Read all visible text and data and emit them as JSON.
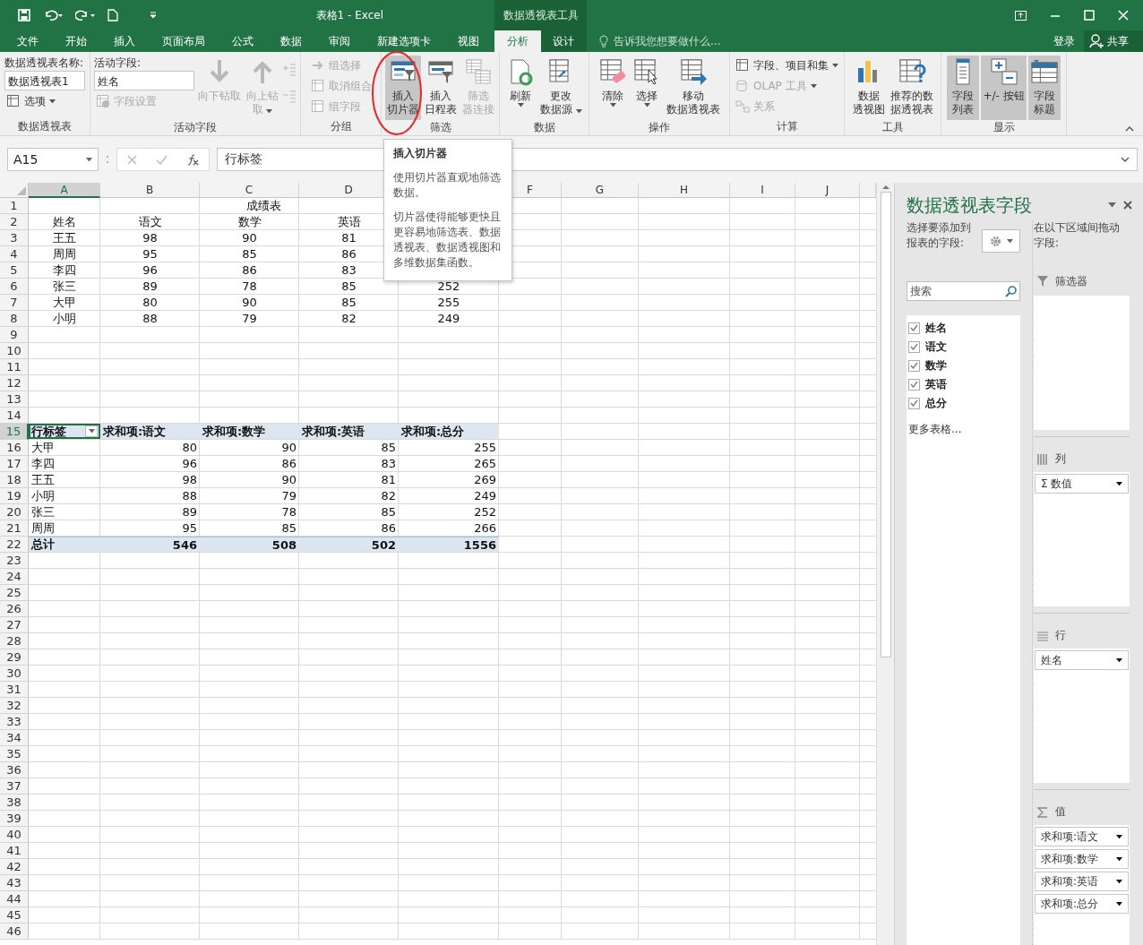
{
  "title_bar": {
    "title": "表格1 - Excel",
    "context_label": "数据透视表工具"
  },
  "tabs": [
    {
      "label": "文件",
      "selected": false
    },
    {
      "label": "开始",
      "selected": false
    },
    {
      "label": "插入",
      "selected": false
    },
    {
      "label": "页面布局",
      "selected": false
    },
    {
      "label": "公式",
      "selected": false
    },
    {
      "label": "数据",
      "selected": false
    },
    {
      "label": "审阅",
      "selected": false
    },
    {
      "label": "新建选项卡",
      "selected": false
    },
    {
      "label": "视图",
      "selected": false
    }
  ],
  "context_tabs": [
    {
      "label": "分析",
      "selected": true
    },
    {
      "label": "设计",
      "selected": false
    }
  ],
  "tell_me": {
    "placeholder": "告诉我您想要做什么..."
  },
  "account": {
    "sign_in": "登录",
    "share": "共享"
  },
  "ribbon": {
    "groups": [
      {
        "label": "数据透视表",
        "columns": [
          [
            {
              "kind": "name_field",
              "label": "数据透视表名称:",
              "value": "数据透视表1"
            },
            {
              "kind": "small",
              "label": "选项",
              "dropdown": true,
              "disabled": false
            }
          ]
        ]
      },
      {
        "label": "活动字段",
        "columns": [
          [
            {
              "kind": "name_field",
              "label": "活动字段:",
              "value": "姓名"
            },
            {
              "kind": "small",
              "label": "字段设置",
              "dropdown": false,
              "disabled": true
            }
          ],
          [
            {
              "kind": "large",
              "lines": [
                "向下钻取"
              ],
              "dropdown": false,
              "disabled": true,
              "on": false,
              "annotated": false
            }
          ],
          [
            {
              "kind": "large",
              "lines": [
                "向上钻",
                "取"
              ],
              "dropdown": true,
              "disabled": true,
              "on": false,
              "annotated": false
            }
          ],
          [
            {
              "kind": "icon_stack",
              "disabled": true
            }
          ]
        ]
      },
      {
        "label": "分组",
        "columns": [
          [
            {
              "kind": "small",
              "label": "组选择",
              "dropdown": false,
              "disabled": true
            },
            {
              "kind": "small",
              "label": "取消组合",
              "dropdown": false,
              "disabled": true
            },
            {
              "kind": "small",
              "label": "组字段",
              "dropdown": false,
              "disabled": true
            }
          ]
        ]
      },
      {
        "label": "筛选",
        "columns": [
          [
            {
              "kind": "large",
              "lines": [
                "插入",
                "切片器"
              ],
              "dropdown": false,
              "disabled": false,
              "on": true,
              "annotated": true
            }
          ],
          [
            {
              "kind": "large",
              "lines": [
                "插入",
                "日程表"
              ],
              "dropdown": false,
              "disabled": false,
              "on": false,
              "annotated": false
            }
          ],
          [
            {
              "kind": "large",
              "lines": [
                "筛选",
                "器连接"
              ],
              "dropdown": false,
              "disabled": true,
              "on": false,
              "annotated": false
            }
          ]
        ]
      },
      {
        "label": "数据",
        "columns": [
          [
            {
              "kind": "large",
              "lines": [
                "刷新"
              ],
              "dropdown": true,
              "disabled": false,
              "on": false,
              "annotated": false
            }
          ],
          [
            {
              "kind": "large",
              "lines": [
                "更改",
                "数据源"
              ],
              "dropdown": true,
              "disabled": false,
              "on": false,
              "annotated": false
            }
          ]
        ]
      },
      {
        "label": "操作",
        "columns": [
          [
            {
              "kind": "large",
              "lines": [
                "清除"
              ],
              "dropdown": true,
              "disabled": false,
              "on": false,
              "annotated": false
            }
          ],
          [
            {
              "kind": "large",
              "lines": [
                "选择"
              ],
              "dropdown": true,
              "disabled": false,
              "on": false,
              "annotated": false
            }
          ],
          [
            {
              "kind": "large",
              "lines": [
                "移动",
                "数据透视表"
              ],
              "dropdown": false,
              "disabled": false,
              "on": false,
              "annotated": false
            }
          ]
        ]
      },
      {
        "label": "计算",
        "columns": [
          [
            {
              "kind": "small",
              "label": "字段、项目和集",
              "dropdown": true,
              "disabled": false
            },
            {
              "kind": "small",
              "label": "OLAP 工具",
              "dropdown": true,
              "disabled": true
            },
            {
              "kind": "small",
              "label": "关系",
              "dropdown": false,
              "disabled": true
            }
          ]
        ]
      },
      {
        "label": "工具",
        "columns": [
          [
            {
              "kind": "large",
              "lines": [
                "数据",
                "透视图"
              ],
              "dropdown": false,
              "disabled": false,
              "on": false,
              "annotated": false
            }
          ],
          [
            {
              "kind": "large",
              "lines": [
                "推荐的数",
                "据透视表"
              ],
              "dropdown": false,
              "disabled": false,
              "on": false,
              "annotated": false
            }
          ]
        ]
      },
      {
        "label": "显示",
        "columns": [
          [
            {
              "kind": "large",
              "lines": [
                "字段",
                "列表"
              ],
              "dropdown": false,
              "disabled": false,
              "on": true,
              "annotated": false
            }
          ],
          [
            {
              "kind": "large",
              "lines": [
                "+/- 按钮"
              ],
              "dropdown": false,
              "disabled": false,
              "on": true,
              "annotated": false
            }
          ],
          [
            {
              "kind": "large",
              "lines": [
                "字段",
                "标题"
              ],
              "dropdown": false,
              "disabled": false,
              "on": true,
              "annotated": false
            }
          ]
        ]
      }
    ]
  },
  "formula_bar": {
    "name_box": "A15",
    "formula": "行标签"
  },
  "sheet": {
    "columns": [
      {
        "label": "A",
        "selected": true
      },
      {
        "label": "B",
        "selected": false
      },
      {
        "label": "C",
        "selected": false
      },
      {
        "label": "D",
        "selected": false
      },
      {},
      {
        "label": "F",
        "selected": false
      },
      {
        "label": "G",
        "selected": false
      },
      {
        "label": "H",
        "selected": false
      },
      {
        "label": "I",
        "selected": false
      },
      {
        "label": "J",
        "selected": false
      }
    ],
    "rows": [
      {
        "label": "1",
        "selected": false
      },
      {
        "label": "2",
        "selected": false
      },
      {
        "label": "3",
        "selected": false
      },
      {
        "label": "4",
        "selected": false
      },
      {
        "label": "5",
        "selected": false
      },
      {
        "label": "6",
        "selected": false
      },
      {
        "label": "7",
        "selected": false
      },
      {
        "label": "8",
        "selected": false
      },
      {
        "label": "9",
        "selected": false
      },
      {
        "label": "10",
        "selected": false
      },
      {
        "label": "11",
        "selected": false
      },
      {
        "label": "12",
        "selected": false
      },
      {
        "label": "13",
        "selected": false
      },
      {
        "label": "14",
        "selected": false
      },
      {
        "label": "15",
        "selected": true
      },
      {
        "label": "16",
        "selected": false
      },
      {
        "label": "17",
        "selected": false
      },
      {
        "label": "18",
        "selected": false
      },
      {
        "label": "19",
        "selected": false
      },
      {
        "label": "20",
        "selected": false
      },
      {
        "label": "21",
        "selected": false
      },
      {
        "label": "22",
        "selected": false
      },
      {
        "label": "23",
        "selected": false
      },
      {
        "label": "24",
        "selected": false
      },
      {
        "label": "25",
        "selected": false
      },
      {
        "label": "26",
        "selected": false
      },
      {
        "label": "27",
        "selected": false
      },
      {
        "label": "28",
        "selected": false
      },
      {
        "label": "29",
        "selected": false
      },
      {
        "label": "30",
        "selected": false
      },
      {
        "label": "31",
        "selected": false
      },
      {
        "label": "32",
        "selected": false
      },
      {
        "label": "33",
        "selected": false
      },
      {
        "label": "34",
        "selected": false
      },
      {
        "label": "35",
        "selected": false
      },
      {
        "label": "36",
        "selected": false
      },
      {
        "label": "37",
        "selected": false
      },
      {
        "label": "38",
        "selected": false
      },
      {
        "label": "39",
        "selected": false
      },
      {
        "label": "40",
        "selected": false
      },
      {
        "label": "41",
        "selected": false
      },
      {
        "label": "42",
        "selected": false
      },
      {
        "label": "43",
        "selected": false
      },
      {
        "label": "44",
        "selected": false
      },
      {
        "label": "45",
        "selected": false
      },
      {
        "label": "46",
        "selected": false
      }
    ],
    "score_table": {
      "title": "成绩表",
      "headers": [
        "姓名",
        "语文",
        "数学",
        "英语"
      ],
      "rows": [
        [
          "王五",
          "98",
          "90",
          "81"
        ],
        [
          "周周",
          "95",
          "85",
          "86"
        ],
        [
          "李四",
          "96",
          "86",
          "83"
        ],
        [
          "张三",
          "89",
          "78",
          "85",
          "252"
        ],
        [
          "大甲",
          "80",
          "90",
          "85",
          "255"
        ],
        [
          "小明",
          "88",
          "79",
          "82",
          "249"
        ]
      ]
    },
    "pivot_table": {
      "headers": [
        "行标签",
        "求和项:语文",
        "求和项:数学",
        "求和项:英语",
        "求和项:总分"
      ],
      "rows": [
        [
          "大甲",
          "80",
          "90",
          "85",
          "255"
        ],
        [
          "李四",
          "96",
          "86",
          "83",
          "265"
        ],
        [
          "王五",
          "98",
          "90",
          "81",
          "269"
        ],
        [
          "小明",
          "88",
          "79",
          "82",
          "249"
        ],
        [
          "张三",
          "89",
          "78",
          "85",
          "252"
        ],
        [
          "周周",
          "95",
          "85",
          "86",
          "266"
        ]
      ],
      "total": [
        "总计",
        "546",
        "508",
        "502",
        "1556"
      ]
    }
  },
  "tooltip": {
    "title": "插入切片器",
    "paragraphs": [
      "使用切片器直观地筛选数据。",
      "切片器使得能够更快且更容易地筛选表、数据透视表、数据透视图和多维数据集函数。"
    ]
  },
  "field_pane": {
    "title": "数据透视表字段",
    "choose_label": "选择要添加到报表的字段:",
    "search": {
      "placeholder": "搜索"
    },
    "fields": [
      {
        "label": "姓名",
        "checked": true
      },
      {
        "label": "语文",
        "checked": true
      },
      {
        "label": "数学",
        "checked": true
      },
      {
        "label": "英语",
        "checked": true
      },
      {
        "label": "总分",
        "checked": true
      }
    ],
    "more_tables": "更多表格...",
    "drag_label": "在以下区域间拖动字段:",
    "areas": [
      {
        "kind": "filter",
        "label": "筛选器"
      },
      {
        "kind": "columns",
        "label": "列",
        "items": [
          "Σ 数值"
        ]
      },
      {
        "kind": "rows",
        "label": "行",
        "items": [
          "姓名"
        ]
      },
      {
        "kind": "values",
        "label": "值",
        "items": [
          "求和项:语文",
          "求和项:数学",
          "求和项:英语",
          "求和项:总分"
        ]
      }
    ]
  }
}
